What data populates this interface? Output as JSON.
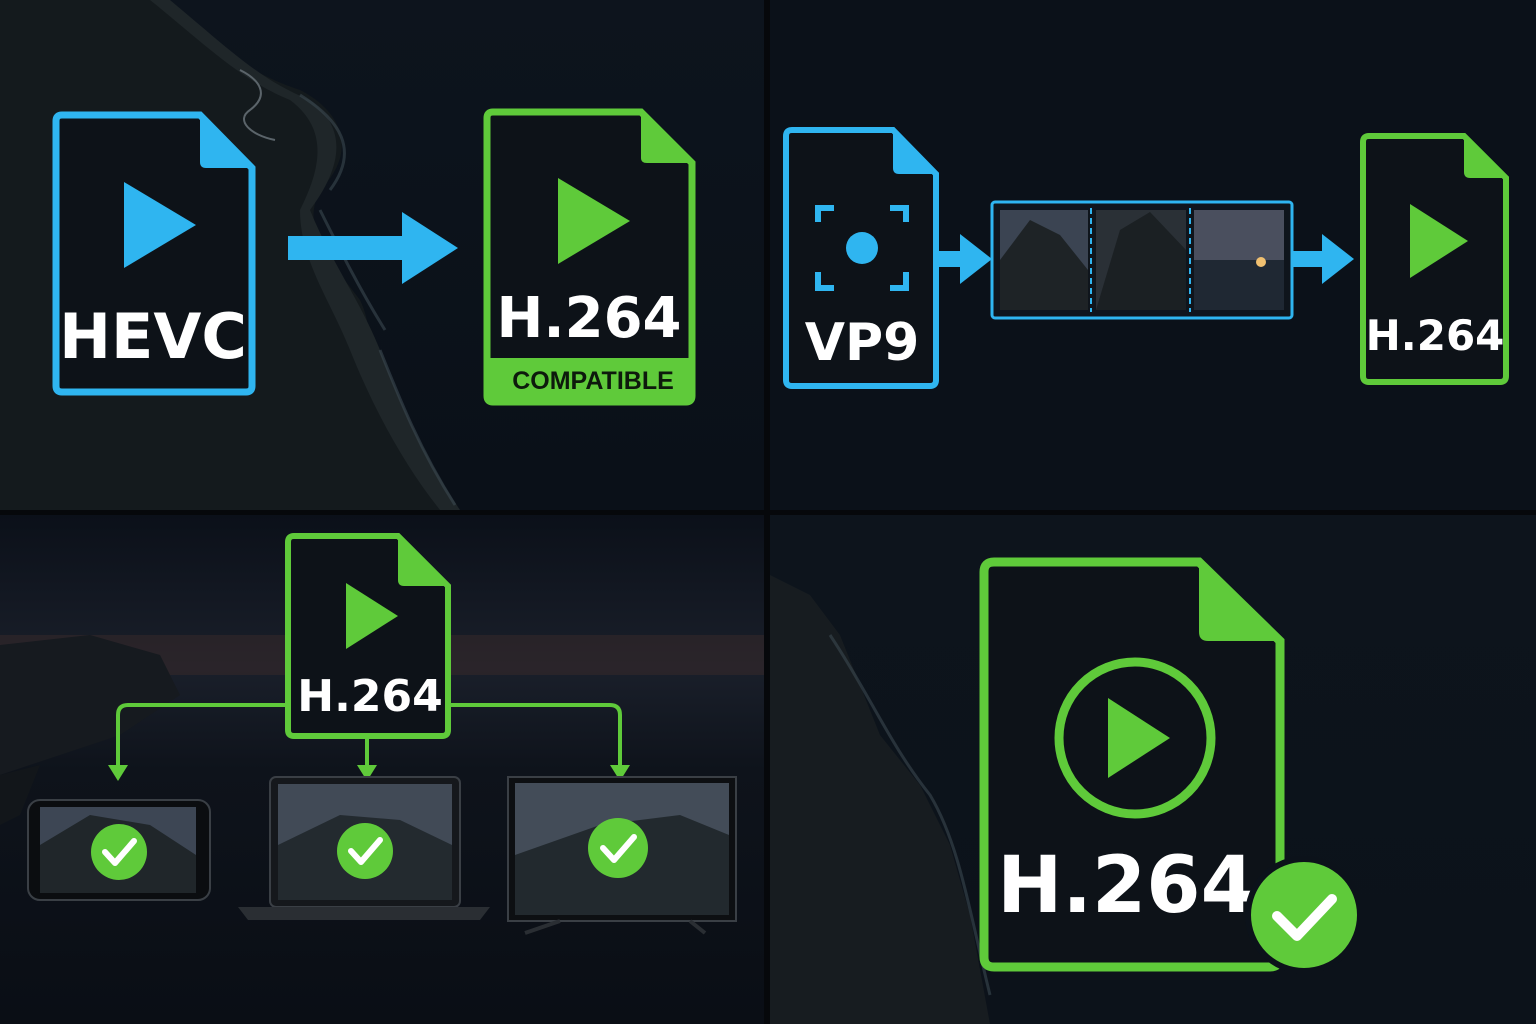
{
  "panel1": {
    "source_label": "HEVC",
    "target_label": "H.264",
    "target_badge": "COMPATIBLE",
    "colors": {
      "source": "#2fb5f0",
      "target": "#5fca3a"
    }
  },
  "panel2": {
    "source_label": "VP9",
    "target_label": "H.264"
  },
  "panel3": {
    "hub_label": "H.264",
    "devices": [
      "phone",
      "laptop",
      "tv"
    ]
  },
  "panel4": {
    "label": "H.264"
  },
  "icons": [
    "play-icon",
    "arrow-icon",
    "camera-focus-icon",
    "checkmark-icon",
    "film-strip-icon"
  ]
}
